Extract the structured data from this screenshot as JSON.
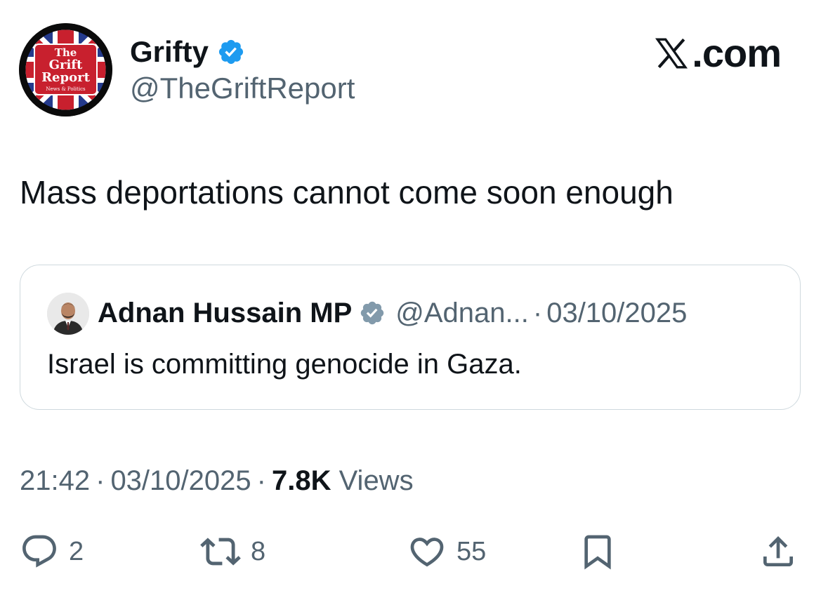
{
  "author": {
    "display_name": "Grifty",
    "handle": "@TheGriftReport",
    "verified": true,
    "avatar_text": {
      "line1": "The",
      "line2": "Grift",
      "line3": "Report",
      "line4": "News & Politics"
    }
  },
  "site": {
    "logo_letter": "X",
    "logo_text": ".com"
  },
  "tweet": {
    "text": "Mass deportations cannot come soon enough"
  },
  "quoted_tweet": {
    "display_name": "Adnan Hussain MP",
    "handle": "@Adnan...",
    "separator": "·",
    "date": "03/10/2025",
    "verified": true,
    "text": "Israel is committing genocide in Gaza."
  },
  "meta": {
    "time": "21:42",
    "separator": "·",
    "date": "03/10/2025",
    "views_count": "7.8K",
    "views_label": "Views"
  },
  "actions": {
    "replies": "2",
    "reposts": "8",
    "likes": "55"
  },
  "colors": {
    "verified_blue": "#1d9bf0",
    "verified_grey": "#829aab",
    "secondary_text": "#536471",
    "border": "#cfd9de"
  }
}
